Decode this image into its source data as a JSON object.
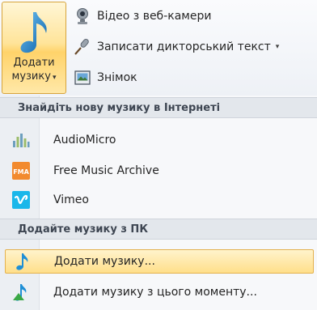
{
  "ribbon": {
    "add_music": {
      "line1": "Додати",
      "line2": "музику",
      "caret": "▾",
      "icon": "music-note-icon"
    },
    "webcam_video": {
      "label": "Відео з веб-камери",
      "icon": "webcam-icon"
    },
    "record_narration": {
      "label": "Записати дикторський текст",
      "icon": "microphone-icon",
      "caret": "▾"
    },
    "snapshot": {
      "label": "Знімок",
      "icon": "snapshot-icon"
    }
  },
  "menu": {
    "online_header": "Знайдіть нову музику в Інтернеті",
    "online_items": [
      {
        "label": "AudioMicro",
        "icon": "audiomicro-icon"
      },
      {
        "label": "Free Music Archive",
        "icon": "fma-icon"
      },
      {
        "label": "Vimeo",
        "icon": "vimeo-icon"
      }
    ],
    "pc_header": "Додайте музику з ПК",
    "pc_items": [
      {
        "label": "Додати музику...",
        "icon": "music-note-icon",
        "highlighted": true
      },
      {
        "label": "Додати музику з цього моменту...",
        "icon": "music-note-green-icon",
        "highlighted": false
      }
    ]
  },
  "colors": {
    "highlight": "#ffdf8a",
    "note_blue": "#1f8fd6",
    "fma_orange": "#f28a2e",
    "vimeo_blue": "#1ab7ea"
  }
}
